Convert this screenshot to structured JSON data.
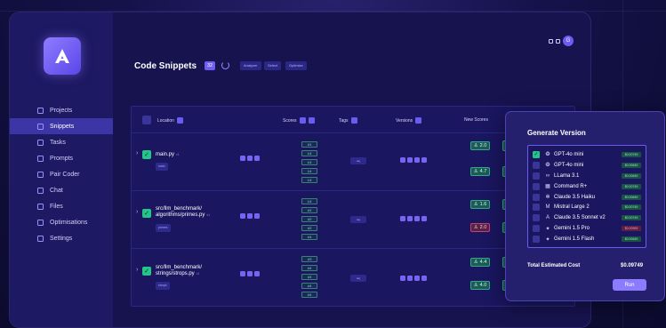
{
  "sidebar": {
    "items": [
      {
        "label": "Projects",
        "active": false
      },
      {
        "label": "Snippets",
        "active": true
      },
      {
        "label": "Tasks",
        "active": false
      },
      {
        "label": "Prompts",
        "active": false
      },
      {
        "label": "Pair Coder",
        "active": false
      },
      {
        "label": "Chat",
        "active": false
      },
      {
        "label": "Files",
        "active": false
      },
      {
        "label": "Optimisations",
        "active": false
      },
      {
        "label": "Settings",
        "active": false
      }
    ]
  },
  "header": {
    "title": "Code Snippets",
    "count": "32",
    "avatar": "G",
    "chips": [
      "Analyzer",
      "Select",
      "Optimize"
    ]
  },
  "table": {
    "columns": {
      "location": "Location",
      "scores": "Scores",
      "tags": "Tags",
      "versions": "Versions",
      "new_scores": "New Scores"
    },
    "rows": [
      {
        "path1": "main.py",
        "path2": "",
        "version": "v1",
        "tag": "main",
        "scores": [
          "4/1",
          "1/4",
          "1/4",
          "1/4",
          "1/4"
        ],
        "tagcell": "tag",
        "new_scores": [
          {
            "value": "2.0",
            "status": "good"
          },
          {
            "value": "4.7",
            "status": "good"
          }
        ]
      },
      {
        "path1": "src/llm_benchmark/",
        "path2": "algorithms/primes.py",
        "version": "v1",
        "tag": "primes",
        "scores": [
          "1/4",
          "4/1",
          "4/2",
          "4/2",
          "4/4"
        ],
        "tagcell": "tag",
        "new_scores": [
          {
            "value": "1.6",
            "status": "good"
          },
          {
            "value": "2.0",
            "status": "bad"
          }
        ]
      },
      {
        "path1": "src/llm_benchmark/",
        "path2": "strings/strops.py",
        "version": "v1",
        "tag": "strops",
        "scores": [
          "4/3",
          "4/4",
          "4/4",
          "4/4",
          "4/4"
        ],
        "tagcell": "tag",
        "new_scores": [
          {
            "value": "4.4",
            "status": "good"
          },
          {
            "value": "4.0",
            "status": "good"
          }
        ]
      }
    ]
  },
  "generate": {
    "title": "Generate Version",
    "models": [
      {
        "name": "GPT-4o mini",
        "icon": "❂",
        "checked": true,
        "price": "$0.00749",
        "price_status": "green"
      },
      {
        "name": "GPT-4o mini",
        "icon": "❂",
        "checked": false,
        "price": "$0.00649",
        "price_status": "green"
      },
      {
        "name": "LLama 3.1",
        "icon": "∞",
        "checked": false,
        "price": "$0.00649",
        "price_status": "green"
      },
      {
        "name": "Command R+",
        "icon": "▦",
        "checked": false,
        "price": "$0.00749",
        "price_status": "green"
      },
      {
        "name": "Claude 3.5 Haiku",
        "icon": "✻",
        "checked": false,
        "price": "$0.00649",
        "price_status": "green"
      },
      {
        "name": "Mistral Large 2",
        "icon": "M",
        "checked": false,
        "price": "$0.00749",
        "price_status": "green"
      },
      {
        "name": "Claude 3.5 Sonnet v2",
        "icon": "A",
        "checked": false,
        "price": "$0.00749",
        "price_status": "green"
      },
      {
        "name": "Gemini 1.5 Pro",
        "icon": "✦",
        "checked": false,
        "price": "$0.00999",
        "price_status": "red"
      },
      {
        "name": "Gemini 1.5 Flash",
        "icon": "✦",
        "checked": false,
        "price": "$0.00649",
        "price_status": "green"
      }
    ],
    "total_label": "Total Estimated Cost",
    "total_value": "$0.09749",
    "run_label": "Run"
  }
}
